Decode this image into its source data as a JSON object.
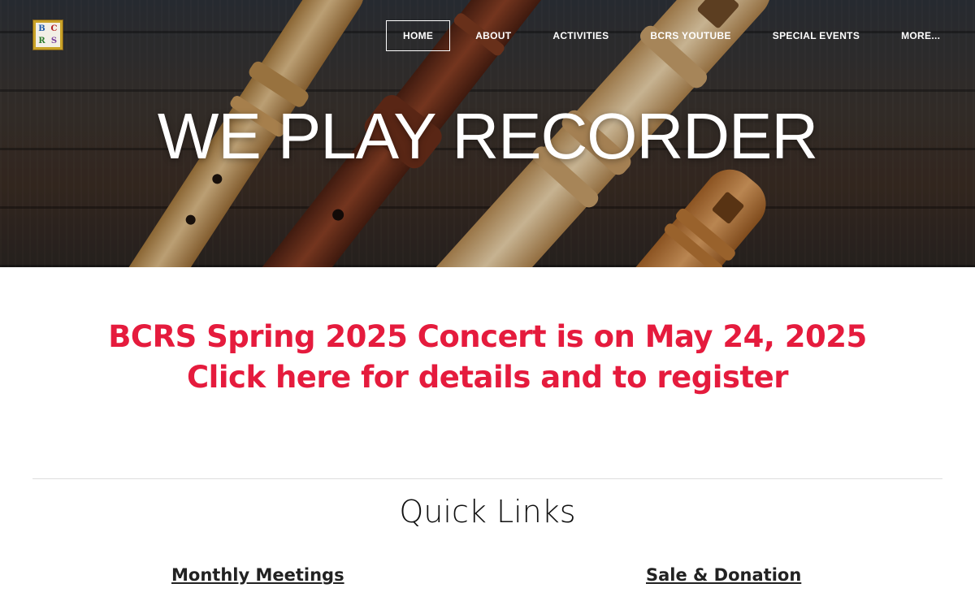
{
  "header": {
    "logo": {
      "letters": [
        "B",
        "C",
        "R",
        "S"
      ],
      "colors": {
        "frame": "#c9a227",
        "b": "#1e5aa8",
        "c": "#b32020",
        "r": "#2c7a2c",
        "s": "#7a3fa0"
      }
    },
    "nav": {
      "items": [
        "HOME",
        "ABOUT",
        "ACTIVITIES",
        "BCRS YOUTUBE",
        "SPECIAL EVENTS",
        "MORE..."
      ],
      "active": "HOME"
    }
  },
  "hero": {
    "title": "WE PLAY RECORDER",
    "background": "recorders-on-wooden-table-photo"
  },
  "announcement": {
    "line1": "BCRS Spring 2025 Concert is on May 24, 2025",
    "line2": "Click here for details and to register",
    "color": "#e51b3d"
  },
  "quick_links": {
    "title": "Quick Links",
    "links": [
      "Monthly Meetings",
      "Sale & Donation"
    ]
  }
}
